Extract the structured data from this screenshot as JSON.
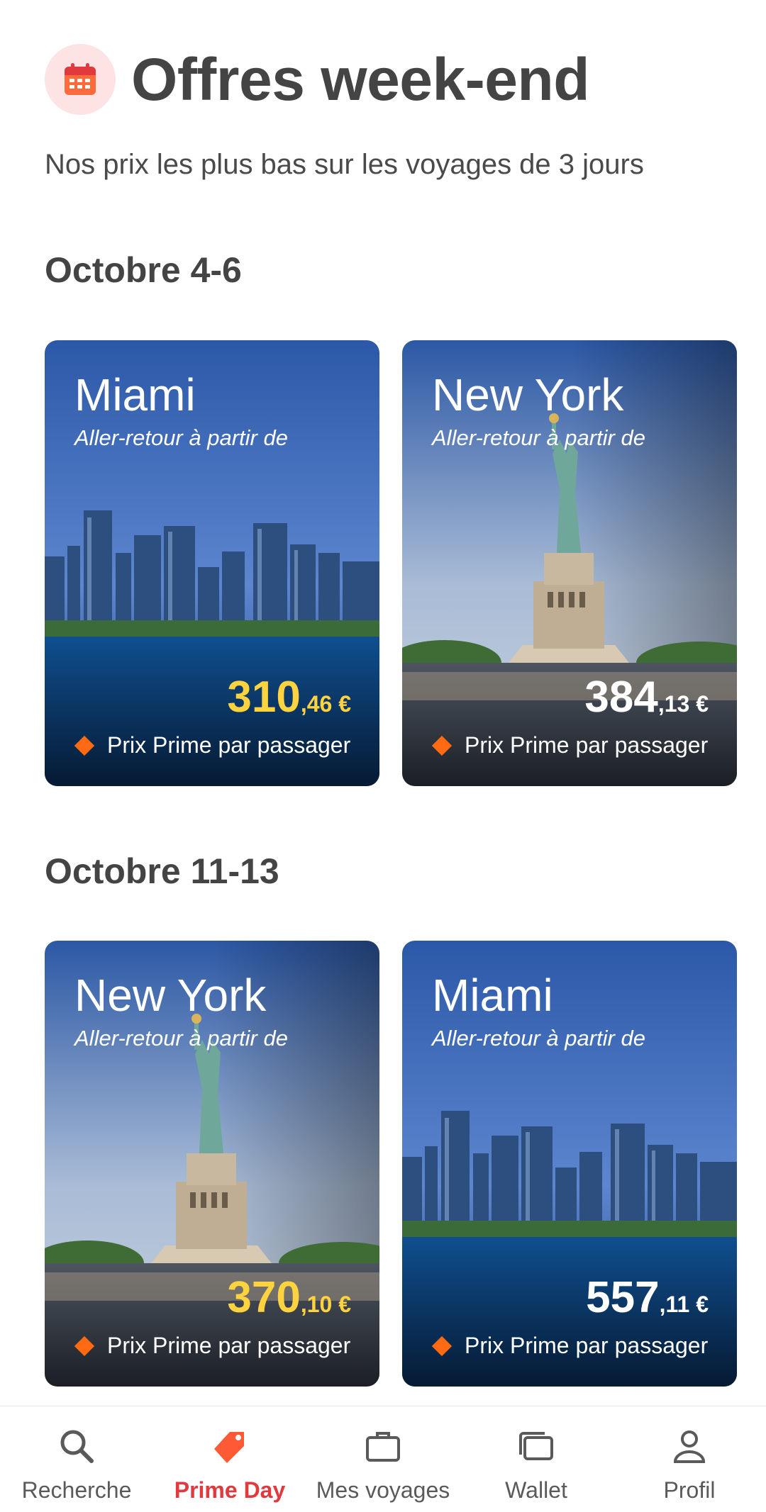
{
  "header": {
    "title": "Offres week-end",
    "subtitle": "Nos prix les plus bas sur les voyages de 3 jours",
    "icon": "calendar-icon"
  },
  "sections": [
    {
      "title": "Octobre 4-6",
      "cards": [
        {
          "city": "Miami",
          "from": "Aller-retour à partir de",
          "price_main": "310",
          "price_cents": ",46 €",
          "price_color": "#ffd23f",
          "prime_label": "Prix Prime par passager",
          "scene": "skyline"
        },
        {
          "city": "New York",
          "from": "Aller-retour à partir de",
          "price_main": "384",
          "price_cents": ",13 €",
          "price_color": "#ffffff",
          "prime_label": "Prix Prime par passager",
          "scene": "statue"
        }
      ]
    },
    {
      "title": "Octobre 11-13",
      "cards": [
        {
          "city": "New York",
          "from": "Aller-retour à partir de",
          "price_main": "370",
          "price_cents": ",10 €",
          "price_color": "#ffd23f",
          "prime_label": "Prix Prime par passager",
          "scene": "statue"
        },
        {
          "city": "Miami",
          "from": "Aller-retour à partir de",
          "price_main": "557",
          "price_cents": ",11 €",
          "price_color": "#ffffff",
          "prime_label": "Prix Prime par passager",
          "scene": "skyline"
        }
      ]
    }
  ],
  "nav": [
    {
      "label": "Recherche",
      "icon": "search-icon",
      "active": false
    },
    {
      "label": "Prime Day",
      "icon": "tag-icon",
      "active": true
    },
    {
      "label": "Mes voyages",
      "icon": "briefcase-icon",
      "active": false
    },
    {
      "label": "Wallet",
      "icon": "wallet-icon",
      "active": false
    },
    {
      "label": "Profil",
      "icon": "profile-icon",
      "active": false
    }
  ],
  "colors": {
    "accent": "#e0393e",
    "orange": "#ff6a13",
    "price_yellow": "#ffd23f",
    "card_blue": "#2f5fb0"
  }
}
